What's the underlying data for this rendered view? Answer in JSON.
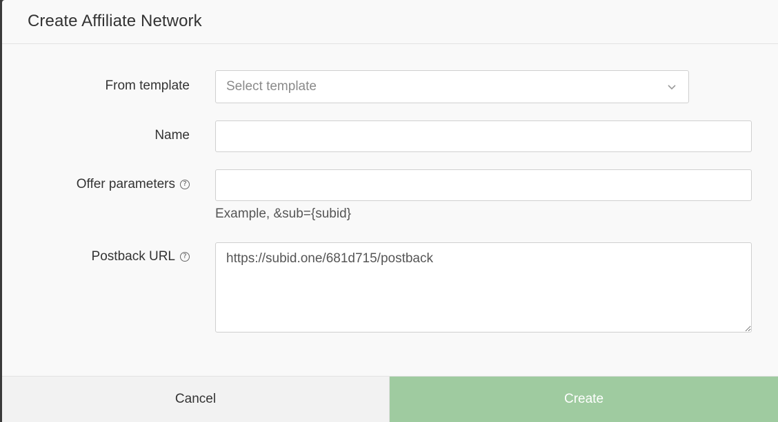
{
  "dialog": {
    "title": "Create Affiliate Network"
  },
  "form": {
    "template": {
      "label": "From template",
      "placeholder": "Select template"
    },
    "name": {
      "label": "Name",
      "value": ""
    },
    "offer_parameters": {
      "label": "Offer parameters",
      "help_icon": "question-circle-icon",
      "value": "",
      "hint": "Example, &sub={subid}"
    },
    "postback_url": {
      "label": "Postback URL",
      "help_icon": "question-circle-icon",
      "value": "https://subid.one/681d715/postback"
    }
  },
  "footer": {
    "cancel_label": "Cancel",
    "create_label": "Create"
  },
  "colors": {
    "create_button_bg": "#9fcba0",
    "cancel_button_bg": "#f2f2f2",
    "dialog_bg": "#f9f9f9"
  }
}
